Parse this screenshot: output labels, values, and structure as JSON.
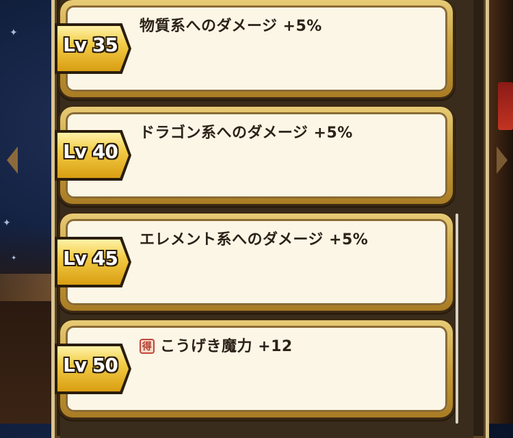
{
  "rewards": [
    {
      "level": "Lv 35",
      "effect": "物質系へのダメージ +5%"
    },
    {
      "level": "Lv 40",
      "effect": "ドラゴン系へのダメージ +5%"
    },
    {
      "level": "Lv 45",
      "effect": "エレメント系へのダメージ +5%"
    },
    {
      "level": "Lv 50",
      "effect": "こうげき魔力 +12",
      "icon": "得"
    }
  ],
  "colors": {
    "card_face": "#fbf6e6",
    "card_border": "#c49a38",
    "badge_gold": "#f2cc46",
    "text": "#2c2218"
  }
}
